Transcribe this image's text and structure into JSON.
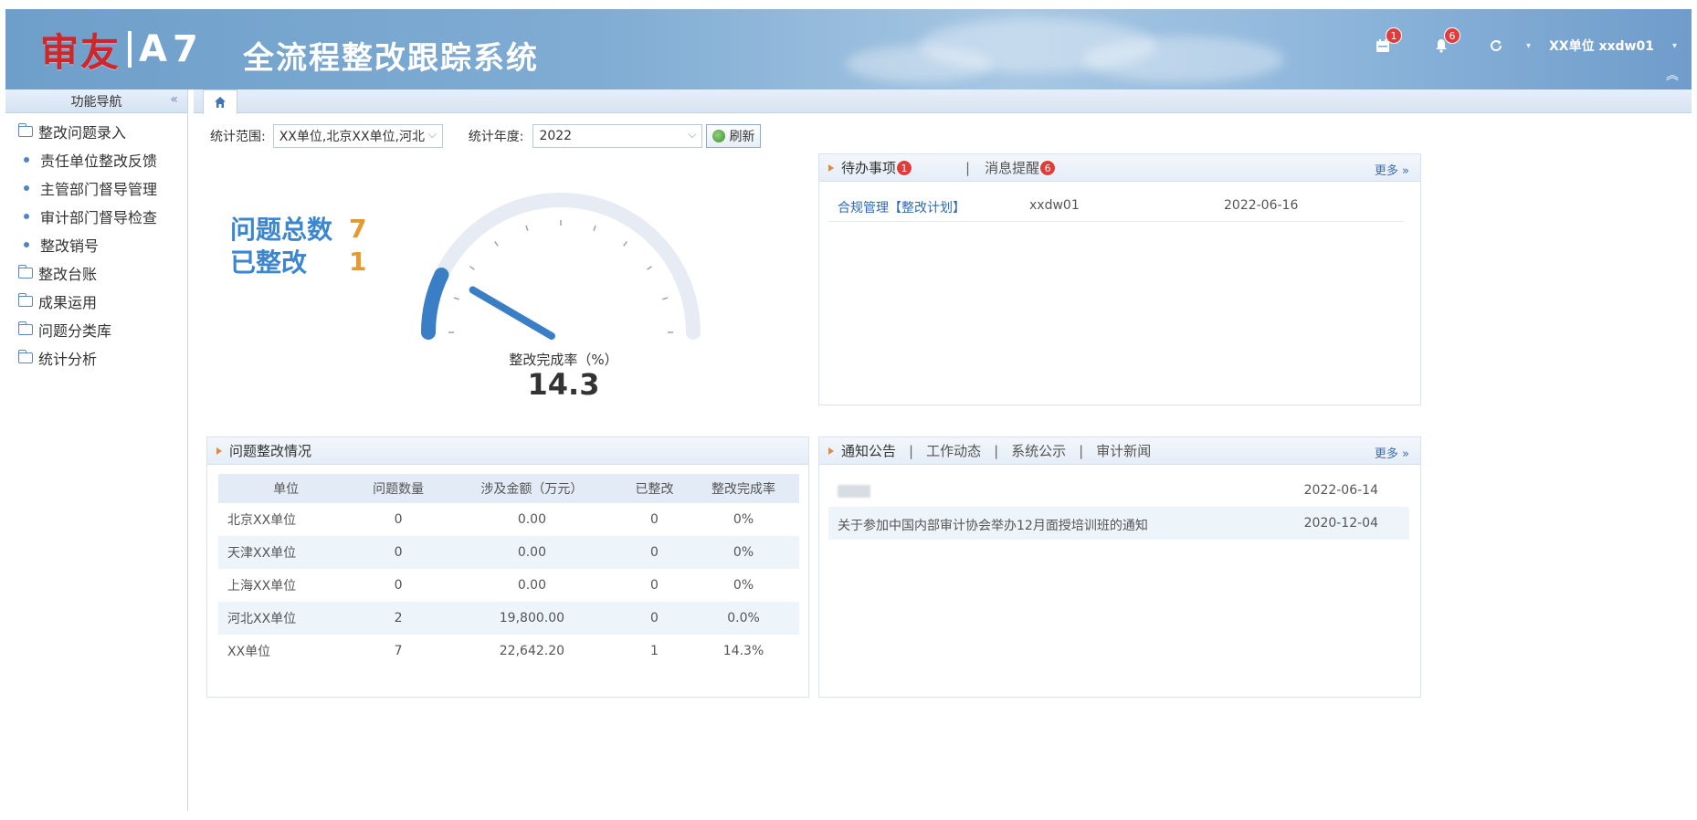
{
  "header": {
    "brand": "审友",
    "model": "A7",
    "system_title": "全流程整改跟踪系统",
    "calendar_badge": "1",
    "bell_badge": "6",
    "user_text": "XX单位 xxdw01",
    "colors": {
      "brand_red": "#d0262a",
      "badge_red": "#e23b3b",
      "header_blue": "#80acd3"
    }
  },
  "sidebar": {
    "title": "功能导航",
    "collapse_glyph": "«",
    "items": [
      {
        "label": "整改问题录入",
        "kind": "folder"
      },
      {
        "label": "责任单位整改反馈",
        "kind": "sub"
      },
      {
        "label": "主管部门督导管理",
        "kind": "sub"
      },
      {
        "label": "审计部门督导检查",
        "kind": "sub"
      },
      {
        "label": "整改销号",
        "kind": "sub"
      },
      {
        "label": "整改台账",
        "kind": "folder"
      },
      {
        "label": "成果运用",
        "kind": "folder"
      },
      {
        "label": "问题分类库",
        "kind": "folder"
      },
      {
        "label": "统计分析",
        "kind": "folder"
      }
    ]
  },
  "filter": {
    "scope_label": "统计范围:",
    "scope_value": "XX单位,北京XX单位,河北",
    "year_label": "统计年度:",
    "year_value": "2022",
    "refresh_label": "刷新"
  },
  "stats": {
    "total_label": "问题总数",
    "total_value": "7",
    "done_label": "已整改",
    "done_value": "1"
  },
  "gauge": {
    "caption": "整改完成率（%）",
    "value": "14.3",
    "percent": 14.3
  },
  "todo_panel": {
    "tab1": "待办事项",
    "tab1_badge": "1",
    "tab2": "消息提醒",
    "tab2_badge": "6",
    "more": "更多 »",
    "rows": [
      {
        "title": "合规管理【整改计划】",
        "user": "xxdw01",
        "date": "2022-06-16"
      }
    ]
  },
  "issue_panel": {
    "title": "问题整改情况",
    "columns": [
      "单位",
      "问题数量",
      "涉及金额（万元）",
      "已整改",
      "整改完成率"
    ],
    "rows": [
      [
        "北京XX单位",
        "0",
        "0.00",
        "0",
        "0%"
      ],
      [
        "天津XX单位",
        "0",
        "0.00",
        "0",
        "0%"
      ],
      [
        "上海XX单位",
        "0",
        "0.00",
        "0",
        "0%"
      ],
      [
        "河北XX单位",
        "2",
        "19,800.00",
        "0",
        "0.0%"
      ],
      [
        "XX单位",
        "7",
        "22,642.20",
        "1",
        "14.3%"
      ]
    ]
  },
  "news_panel": {
    "tabs": [
      "通知公告",
      "工作动态",
      "系统公示",
      "审计新闻"
    ],
    "more": "更多 »",
    "rows": [
      {
        "title": "",
        "date": "2022-06-14"
      },
      {
        "title": "关于参加中国内部审计协会举办12月面授培训班的通知",
        "date": "2020-12-04"
      }
    ]
  }
}
